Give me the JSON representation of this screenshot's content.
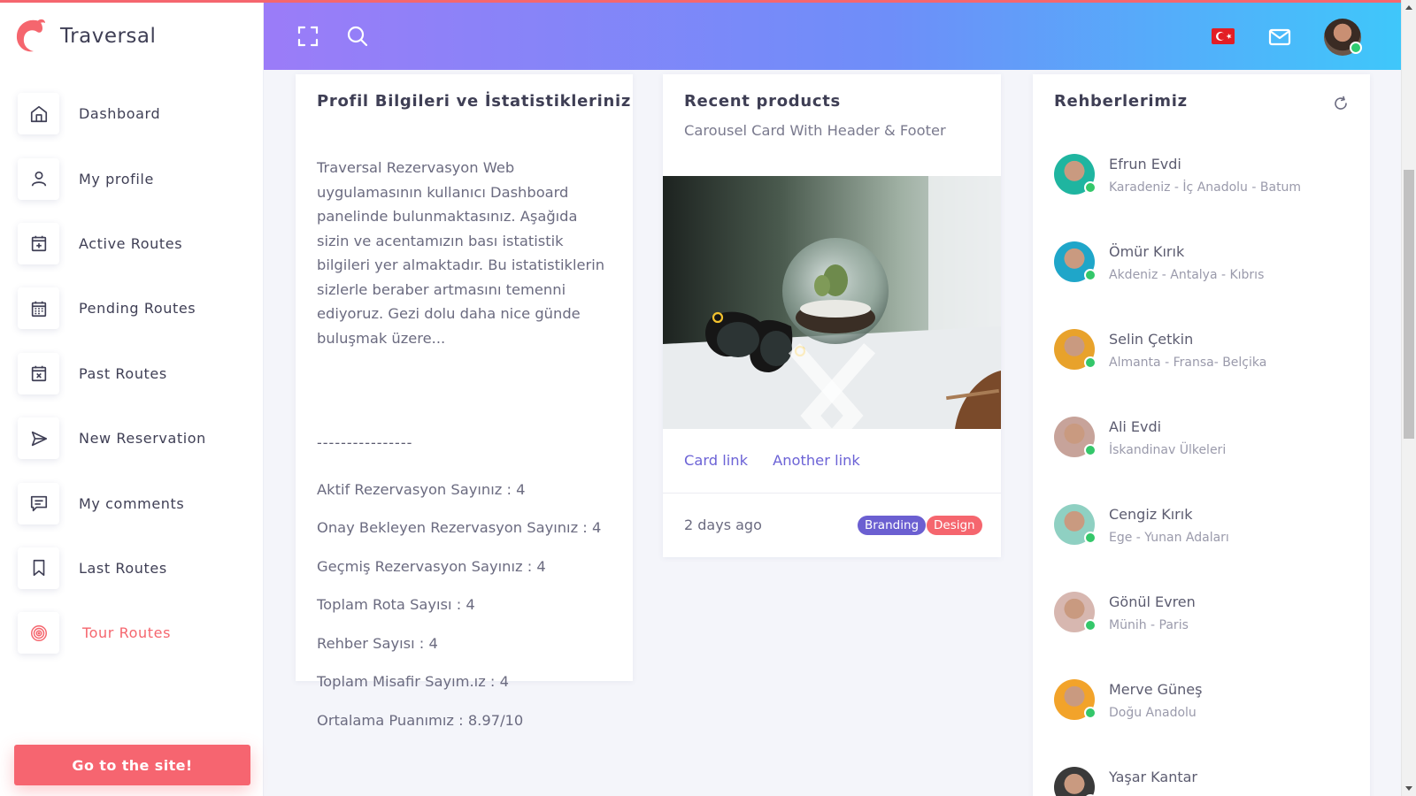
{
  "app": {
    "brand": "Traversal",
    "accent_color": "#f5666e",
    "header_gradient": [
      "#9b7cf8",
      "#3fc7fa"
    ]
  },
  "sidebar": {
    "items": [
      {
        "label": "Dashboard",
        "icon": "home-icon"
      },
      {
        "label": "My profile",
        "icon": "user-icon"
      },
      {
        "label": "Active Routes",
        "icon": "calendar-plus-icon"
      },
      {
        "label": "Pending Routes",
        "icon": "calendar-grid-icon"
      },
      {
        "label": "Past Routes",
        "icon": "calendar-x-icon"
      },
      {
        "label": "New Reservation",
        "icon": "send-icon"
      },
      {
        "label": "My comments",
        "icon": "comment-icon"
      },
      {
        "label": "Last Routes",
        "icon": "bookmark-icon"
      },
      {
        "label": "Tour Routes",
        "icon": "target-icon",
        "active": true
      }
    ],
    "cta_label": "Go to the site!"
  },
  "header": {
    "icons": [
      "fullscreen-icon",
      "search-icon",
      "turkey-flag-icon",
      "mail-icon",
      "user-avatar"
    ]
  },
  "profile_card": {
    "title": "Profil Bilgileri ve İstatistikleriniz",
    "description": "Traversal Rezervasyon Web uygulamasının kullanıcı Dashboard panelinde bulunmaktasınız. Aşağıda sizin ve acentamızın bası istatistik bilgileri yer almaktadır. Bu istatistiklerin sizlerle beraber artmasını temenni ediyoruz. Gezi dolu daha nice günde buluşmak üzere...",
    "separator": "----------------",
    "stats": [
      "Aktif Rezervasyon Sayınız : 4",
      "Onay Bekleyen Rezervasyon Sayınız : 4",
      "Geçmiş Rezervasyon Sayınız : 4",
      "Toplam Rota Sayısı : 4",
      "Rehber Sayısı : 4",
      "Toplam Misafir Sayım.ız : 4",
      "Ortalama Puanımız : 8.97/10"
    ]
  },
  "products_card": {
    "title": "Recent products",
    "subtitle": "Carousel Card With Header & Footer",
    "links": [
      "Card link",
      "Another link"
    ],
    "footer_time": "2 days ago",
    "badges": [
      "Branding",
      "Design"
    ]
  },
  "guides_card": {
    "title": "Rehberlerimiz",
    "guides": [
      {
        "name": "Efrun Evdi",
        "region": "Karadeniz - İç Anadolu - Batum",
        "color": "#1fb5a0"
      },
      {
        "name": "Ömür Kırık",
        "region": "Akdeniz - Antalya - Kıbrıs",
        "color": "#1fa6c9"
      },
      {
        "name": "Selin Çetkin",
        "region": "Almanta - Fransa- Belçika",
        "color": "#e8a22b"
      },
      {
        "name": "Ali Evdi",
        "region": "İskandinav Ülkeleri",
        "color": "#c7a39a"
      },
      {
        "name": "Cengiz Kırık",
        "region": "Ege - Yunan Adaları",
        "color": "#8fd0c2"
      },
      {
        "name": "Gönül Evren",
        "region": "Münih - Paris",
        "color": "#d7b7b0"
      },
      {
        "name": "Merve Güneş",
        "region": "Doğu Anadolu",
        "color": "#f2a32a"
      },
      {
        "name": "Yaşar Kantar",
        "region": "",
        "color": "#3a3a3a"
      }
    ]
  }
}
